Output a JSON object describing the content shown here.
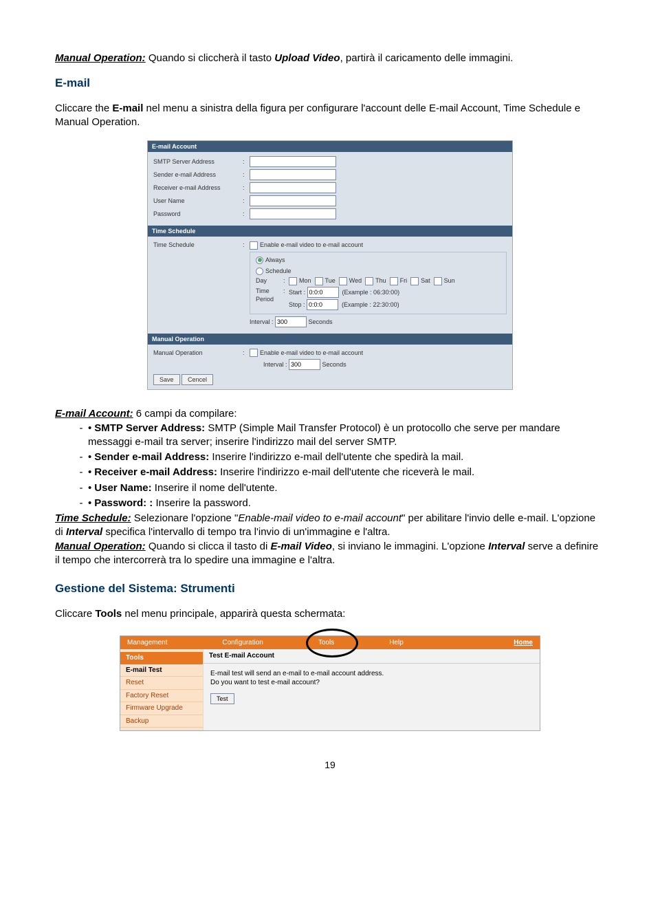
{
  "intro_line": {
    "label1": "Manual Operation:",
    "text1": " Quando si cliccherà il tasto ",
    "label2": "Upload Video",
    "text2": ", partirà il caricamento delle immagini."
  },
  "email_section": {
    "heading": "E-mail",
    "line1a": "Cliccare the ",
    "line1b": "E-mail",
    "line1c": " nel menu a sinistra della figura per configurare l'account delle E-mail Account, Time Schedule e Manual Operation."
  },
  "ss1": {
    "sec1": "E-mail Account",
    "rows1": [
      {
        "label": "SMTP Server Address",
        "val": ""
      },
      {
        "label": "Sender e-mail Address",
        "val": ""
      },
      {
        "label": "Receiver e-mail Address",
        "val": ""
      },
      {
        "label": "User Name",
        "val": ""
      },
      {
        "label": "Password",
        "val": ""
      }
    ],
    "sec2": "Time Schedule",
    "ts_label": "Time Schedule",
    "enable_cb": "Enable e-mail video to e-mail account",
    "always": "Always",
    "schedule": "Schedule",
    "day_label": "Day",
    "days": [
      "Mon",
      "Tue",
      "Wed",
      "Thu",
      "Fri",
      "Sat",
      "Sun"
    ],
    "time_period_label": "Time Period",
    "start_label": "Start :",
    "start_val": "0:0:0",
    "start_ex": "(Example : 06:30:00)",
    "stop_label": "Stop :",
    "stop_val": "0:0:0",
    "stop_ex": "(Example : 22:30:00)",
    "interval_label": "Interval :",
    "interval_val": "300",
    "interval_unit": "Seconds",
    "sec3": "Manual Operation",
    "mo_label": "Manual Operation",
    "mo_cb": "Enable e-mail video to e-mail account",
    "mo_interval_label": "Interval :",
    "mo_interval_val": "300",
    "mo_interval_unit": "Seconds",
    "save": "Save",
    "cancel": "Cencel"
  },
  "account_block": {
    "title": "E-mail Account:",
    "intro": " 6 campi da compilare:",
    "items": [
      {
        "b": "SMTP Server Address:",
        "t": " SMTP (Simple Mail Transfer Protocol) è un protocollo che serve per mandare messaggi e-mail tra server; inserire l'indirizzo mail del server SMTP."
      },
      {
        "b": "Sender e-mail Address:",
        "t": " Inserire l'indirizzo e-mail dell'utente che spedirà la mail."
      },
      {
        "b": "Receiver e-mail Address:",
        "t": " Inserire l'indirizzo e-mail dell'utente che riceverà le mail."
      },
      {
        "b": "User Name:",
        "t": " Inserire il nome dell'utente."
      },
      {
        "b": "Password: :",
        "t": " Inserire  la password."
      }
    ]
  },
  "time_block": {
    "title": "Time Schedule:",
    "text1": " Selezionare l'opzione \"",
    "ital1": "Enable-mail video to e-mail account",
    "text2": "\" per abilitare l'invio delle e-mail. L'opzione di ",
    "bi1": "Interval",
    "text3": " specifica l'intervallo di tempo tra l'invio di un'immagine e l'altra."
  },
  "manual_block": {
    "title": "Manual Operation:",
    "text1": " Quando si clicca il tasto di ",
    "bi1": "E-mail Video",
    "text2": ", si inviano le immagini. L'opzione ",
    "bi2": "Interval",
    "text3": " serve a definire il tempo che intercorrerà tra lo spedire una immagine e l'altra."
  },
  "gestione": {
    "heading": "Gestione del Sistema: Strumenti",
    "line_a": "Cliccare ",
    "line_b": "Tools",
    "line_c": " nel menu principale, apparirà questa schermata:"
  },
  "ss2": {
    "nav": [
      "Management",
      "Configuration",
      "Tools",
      "Help"
    ],
    "home": "Home",
    "side_header": "Tools",
    "side_items": [
      "E-mail Test",
      "Reset",
      "Factory Reset",
      "Firmware Upgrade",
      "Backup"
    ],
    "main_header": "Test E-mail Account",
    "main_l1": "E-mail test will send an e-mail to e-mail account address.",
    "main_l2": "Do you want to test e-mail account?",
    "test_btn": "Test"
  },
  "page_number": "19"
}
